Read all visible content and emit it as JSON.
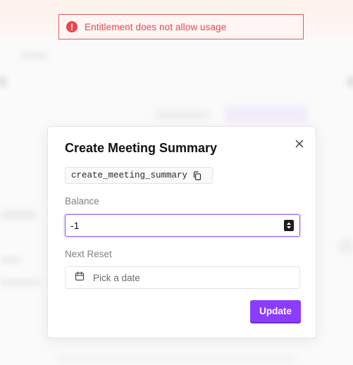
{
  "toast": {
    "message": "Entitlement does not allow usage",
    "color": "#e5484d",
    "icon": "alert-circle-icon"
  },
  "modal": {
    "title": "Create Meeting Summary",
    "feature_key": "create_meeting_summary",
    "balance": {
      "label": "Balance",
      "value": "-1"
    },
    "next_reset": {
      "label": "Next Reset",
      "placeholder": "Pick a date"
    },
    "update_label": "Update",
    "accent_color": "#8b3dff"
  }
}
